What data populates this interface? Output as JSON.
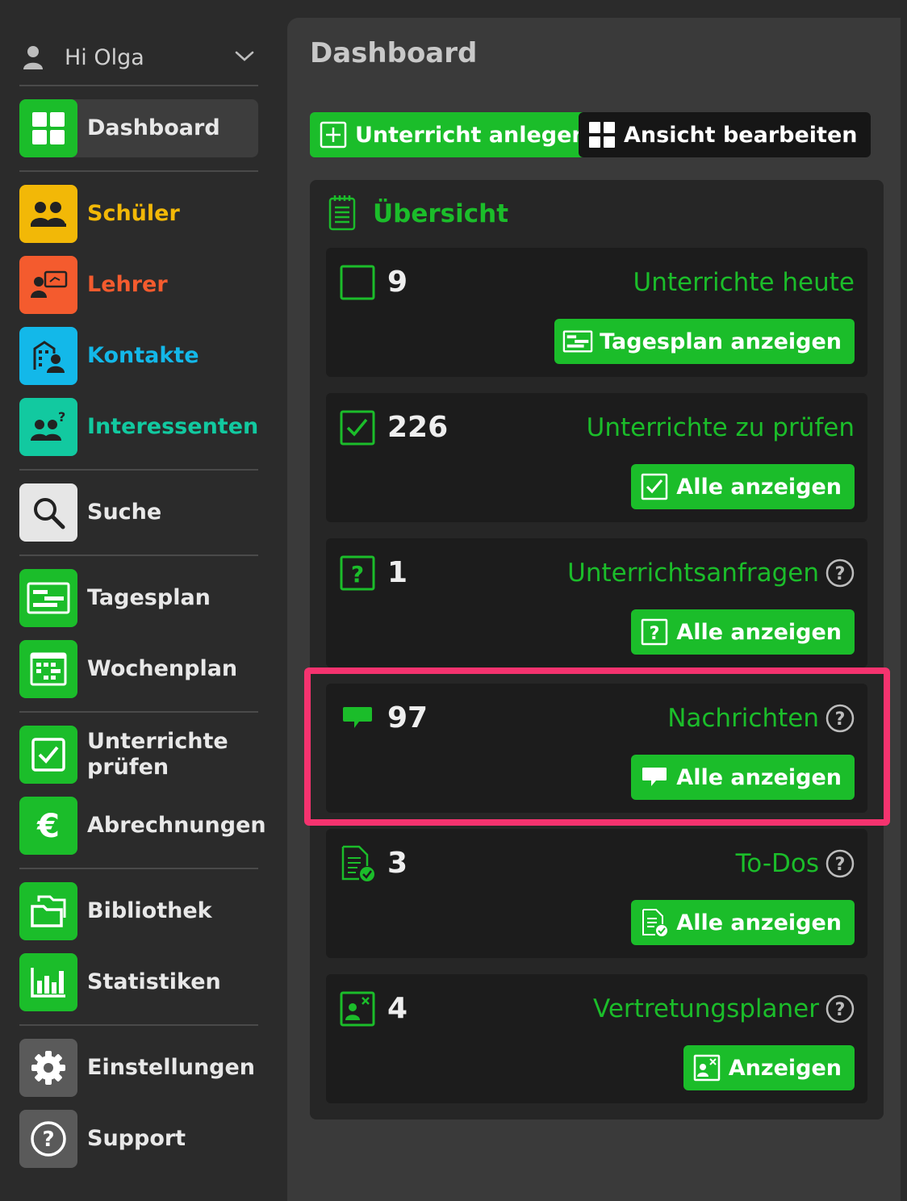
{
  "user": {
    "greeting": "Hi Olga"
  },
  "sidebar": {
    "items": [
      {
        "label": "Dashboard",
        "color": "#1bbd2a",
        "text_color": "#e8e8e8",
        "icon": "dashboard-icon",
        "active": true
      },
      {
        "label": "Schüler",
        "color": "#f2b807",
        "text_color": "#f2b807",
        "icon": "students-icon"
      },
      {
        "label": "Lehrer",
        "color": "#f45b2e",
        "text_color": "#f45b2e",
        "icon": "teacher-icon"
      },
      {
        "label": "Kontakte",
        "color": "#13b8e9",
        "text_color": "#13b8e9",
        "icon": "contacts-icon"
      },
      {
        "label": "Interessenten",
        "color": "#12c9a0",
        "text_color": "#12c9a0",
        "icon": "prospects-icon"
      },
      {
        "label": "Suche",
        "color": "#e6e6e6",
        "text_color": "#e8e8e8",
        "icon": "search-icon"
      },
      {
        "label": "Tagesplan",
        "color": "#1bbd2a",
        "text_color": "#e8e8e8",
        "icon": "day-plan-icon"
      },
      {
        "label": "Wochenplan",
        "color": "#1bbd2a",
        "text_color": "#e8e8e8",
        "icon": "week-plan-icon"
      },
      {
        "label_line1": "Unterrichte",
        "label_line2": "prüfen",
        "color": "#1bbd2a",
        "text_color": "#e8e8e8",
        "icon": "check-lessons-icon"
      },
      {
        "label": "Abrechnungen",
        "color": "#1bbd2a",
        "text_color": "#e8e8e8",
        "icon": "euro-icon"
      },
      {
        "label": "Bibliothek",
        "color": "#1bbd2a",
        "text_color": "#e8e8e8",
        "icon": "library-icon"
      },
      {
        "label": "Statistiken",
        "color": "#1bbd2a",
        "text_color": "#e8e8e8",
        "icon": "statistics-icon"
      },
      {
        "label": "Einstellungen",
        "color": "#5a5a5a",
        "text_color": "#e8e8e8",
        "icon": "gear-icon"
      },
      {
        "label": "Support",
        "color": "#5a5a5a",
        "text_color": "#e8e8e8",
        "icon": "help-icon"
      }
    ]
  },
  "main": {
    "title": "Dashboard",
    "toolbar": {
      "create_lesson": "Unterricht anlegen",
      "edit_view": "Ansicht bearbeiten"
    },
    "overview": {
      "title": "Übersicht",
      "cards": [
        {
          "count": "9",
          "label": "Unterrichte heute",
          "button": "Tagesplan anzeigen",
          "icon": "empty-checkbox-icon",
          "help": false
        },
        {
          "count": "226",
          "label": "Unterrichte zu prüfen",
          "button": "Alle anzeigen",
          "icon": "checked-box-icon",
          "help": false
        },
        {
          "count": "1",
          "label": "Unterrichtsanfragen",
          "button": "Alle anzeigen",
          "icon": "question-box-icon",
          "help": true
        },
        {
          "count": "97",
          "label": "Nachrichten",
          "button": "Alle anzeigen",
          "icon": "message-icon",
          "help": true,
          "highlighted": true
        },
        {
          "count": "3",
          "label": "To-Dos",
          "button": "Alle anzeigen",
          "icon": "todo-list-icon",
          "help": true
        },
        {
          "count": "4",
          "label": "Vertretungsplaner",
          "button": "Anzeigen",
          "icon": "substitution-icon",
          "help": true
        }
      ]
    }
  },
  "colors": {
    "accent": "#1bbd2a",
    "highlight": "#f5336f",
    "panel": "#3a3a3a",
    "card": "#1c1c1c"
  }
}
